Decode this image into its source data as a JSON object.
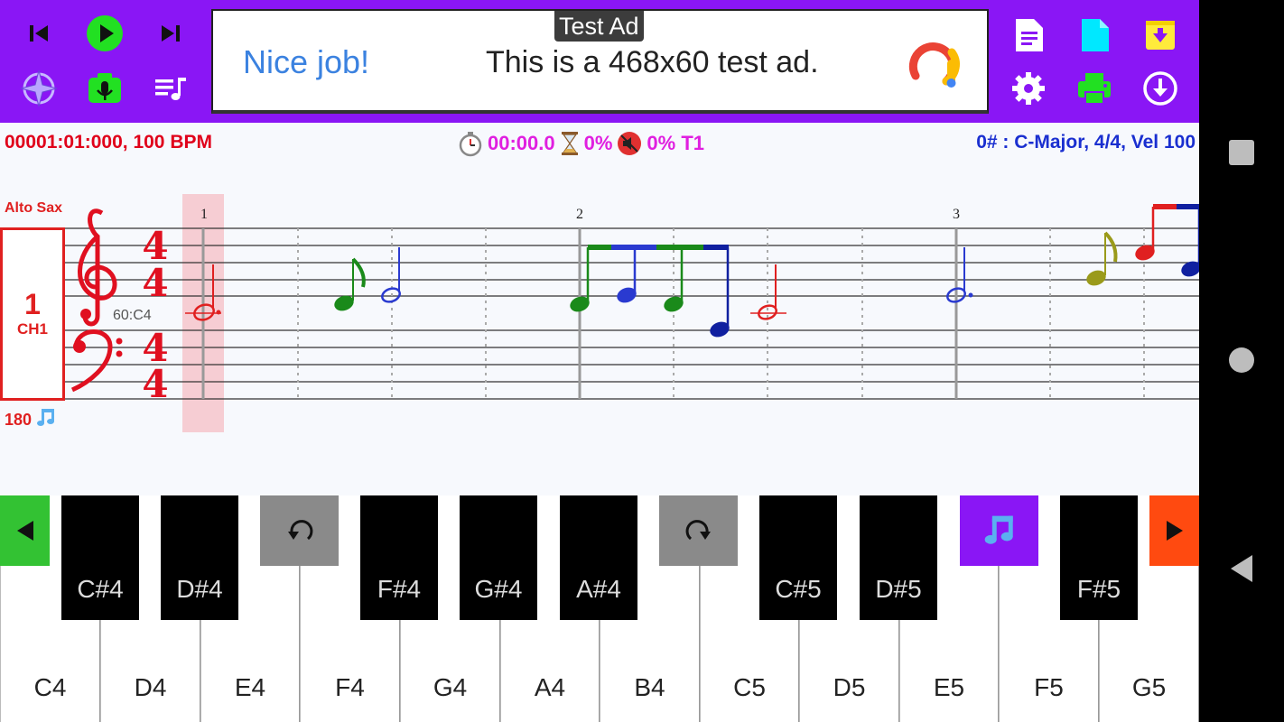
{
  "toolbar": {
    "left_icons": [
      "skip-previous-icon",
      "play-icon",
      "skip-next-icon",
      "compass-icon",
      "camera-mic-icon",
      "playlist-icon"
    ],
    "right_icons": [
      "document-icon",
      "new-file-icon",
      "archive-icon",
      "settings-icon",
      "print-icon",
      "download-icon"
    ]
  },
  "ad": {
    "badge": "Test Ad",
    "headline": "Nice job!",
    "text": "This is a 468x60 test ad."
  },
  "status": {
    "position": "00001:01:000, 100 BPM",
    "timer": "00:00.0",
    "progress": "0%",
    "mute_pct": "0% T1",
    "key_info": "0# : C-Major, 4/4, Vel 100"
  },
  "track": {
    "name": "Alto Sax",
    "channel_number": "1",
    "channel_label": "CH1",
    "tempo_count": "180",
    "note_label": "60:C4",
    "time_signature_top": "4",
    "time_signature_bottom": "4"
  },
  "measures": [
    "1",
    "2",
    "3"
  ],
  "keyboard": {
    "white_keys": [
      "C4",
      "D4",
      "E4",
      "F4",
      "G4",
      "A4",
      "B4",
      "C5",
      "D5",
      "E5",
      "F5",
      "G5"
    ],
    "black_keys": [
      "C#4",
      "D#4",
      "F#4",
      "G#4",
      "A#4",
      "C#5",
      "D#5",
      "F#5"
    ],
    "undo_icon": "undo-icon",
    "redo_icon": "redo-icon",
    "note_icon": "music-note-icon",
    "prev_icon": "scroll-left-icon",
    "next_icon": "scroll-right-icon"
  },
  "colors": {
    "toolbar_bg": "#8a16f5",
    "accent_red": "#e02020",
    "accent_green": "#2bd02b",
    "accent_orange": "#ff4a10",
    "accent_purple": "#8a16f5"
  },
  "navbar": {
    "icons": [
      "recents-square-icon",
      "home-circle-icon",
      "back-triangle-icon"
    ]
  }
}
